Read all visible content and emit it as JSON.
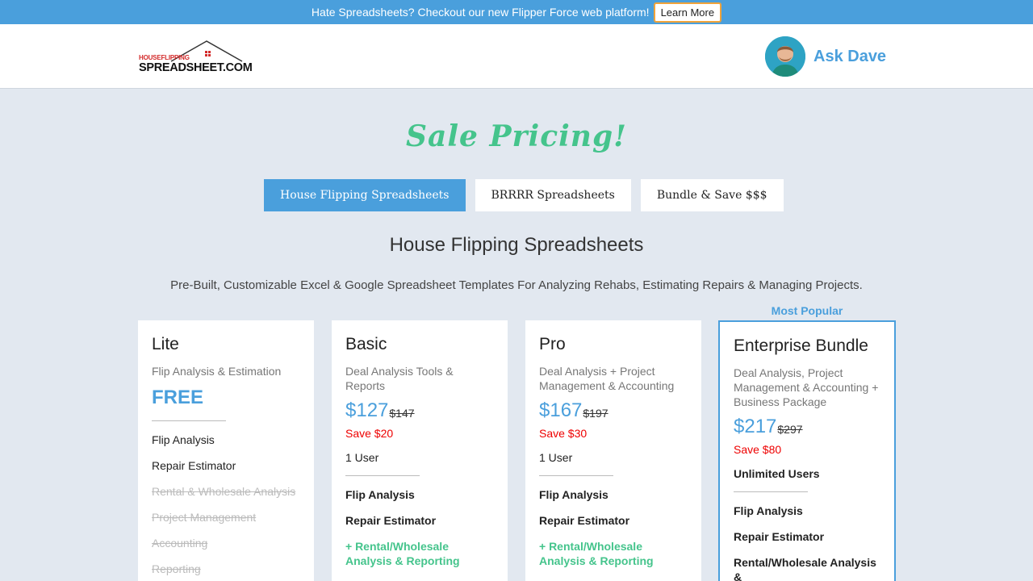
{
  "promo": {
    "text": "Hate Spreadsheets? Checkout our new Flipper Force web platform!",
    "button": "Learn More"
  },
  "header": {
    "logo_top": "HOUSEFLIPPING",
    "logo_main": "SPREADSHEET.COM",
    "ask_label": "Ask Dave"
  },
  "page": {
    "sale_title": "Sale Pricing!",
    "section_title": "House Flipping Spreadsheets",
    "section_sub": "Pre-Built, Customizable Excel & Google Spreadsheet Templates For Analyzing Rehabs, Estimating Repairs & Managing Projects.",
    "most_popular": "Most Popular"
  },
  "tabs": [
    {
      "label": "House Flipping Spreadsheets",
      "active": true
    },
    {
      "label": "BRRRR Spreadsheets",
      "active": false
    },
    {
      "label": "Bundle & Save $$$",
      "active": false
    }
  ],
  "plans": {
    "lite": {
      "name": "Lite",
      "desc": "Flip Analysis & Estimation",
      "price": "FREE",
      "features": [
        "Flip Analysis",
        "Repair Estimator",
        "Rental & Wholesale Analysis",
        "Project Management",
        "Accounting",
        "Reporting"
      ]
    },
    "basic": {
      "name": "Basic",
      "desc": "Deal Analysis Tools & Reports",
      "price": "$127",
      "old_price": "$147",
      "save": "Save $20",
      "users": "1 User",
      "features": [
        "Flip Analysis",
        "Repair Estimator",
        "+ Rental/Wholesale Analysis & Reporting"
      ]
    },
    "pro": {
      "name": "Pro",
      "desc": "Deal Analysis + Project Management & Accounting",
      "price": "$167",
      "old_price": "$197",
      "save": "Save $30",
      "users": "1 User",
      "features": [
        "Flip Analysis",
        "Repair Estimator",
        "+ Rental/Wholesale Analysis & Reporting"
      ]
    },
    "enterprise": {
      "name": "Enterprise Bundle",
      "desc": "Deal Analysis, Project Management & Accounting + Business Package",
      "price": "$217",
      "old_price": "$297",
      "save": "Save $80",
      "users": "Unlimited Users",
      "features": [
        "Flip Analysis",
        "Repair Estimator",
        "Rental/Wholesale Analysis &"
      ]
    }
  },
  "colors": {
    "accent": "#4a9fdc",
    "green": "#45c48c",
    "save_red": "#e00000",
    "background": "#e2e8f0"
  }
}
